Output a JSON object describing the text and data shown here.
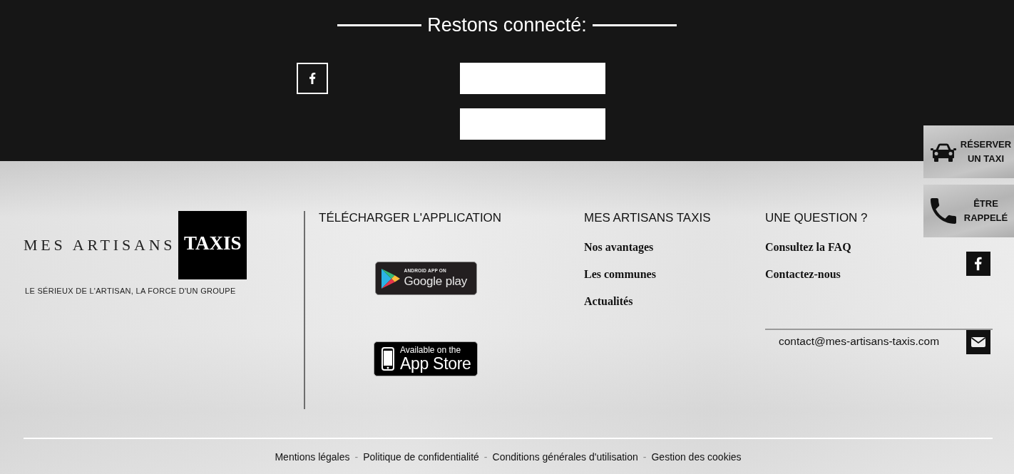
{
  "connect_section": {
    "title": "Restons connecté:"
  },
  "brand": {
    "name": "MES ARTISANS",
    "badge": "TAXIS",
    "tagline": "LE SÉRIEUX DE L'ARTISAN, LA FORCE D'UN GROUPE"
  },
  "app_download": {
    "heading": "TÉLÉCHARGER L'APPLICATION",
    "badges": [
      {
        "kind": "google-play",
        "caption": "ANDROID APP ON",
        "label": "Google play"
      },
      {
        "kind": "app-store",
        "caption": "Available on the",
        "label": "App Store"
      }
    ]
  },
  "site_links": {
    "heading": "MES ARTISANS TAXIS",
    "links": [
      "Nos avantages",
      "Les communes",
      "Actualités"
    ]
  },
  "question": {
    "heading": "UNE QUESTION ?",
    "links": [
      "Consultez la FAQ",
      "Contactez-nous"
    ],
    "email": "contact@mes-artisans-taxis.com"
  },
  "footer": {
    "items": [
      {
        "kind": "link",
        "text": "Mentions légales"
      },
      {
        "kind": "separator",
        "text": "-"
      },
      {
        "kind": "link",
        "text": "Politique de confidentialité"
      },
      {
        "kind": "separator",
        "text": "-"
      },
      {
        "kind": "link",
        "text": "Conditions générales d'utilisation"
      },
      {
        "kind": "separator",
        "text": "-"
      },
      {
        "kind": "link",
        "text": "Gestion des cookies"
      }
    ]
  },
  "side_buttons": [
    {
      "kind": "car",
      "label": "RÉSERVER UN TAXI"
    },
    {
      "kind": "phone",
      "label": "ÊTRE RAPPELÉ"
    }
  ]
}
